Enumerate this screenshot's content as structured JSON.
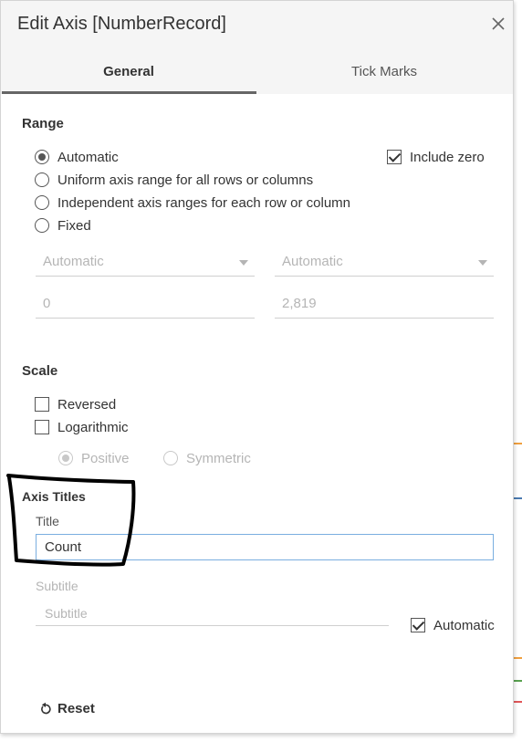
{
  "dialog": {
    "title": "Edit Axis [NumberRecord]"
  },
  "tabs": [
    {
      "label": "General",
      "active": true
    },
    {
      "label": "Tick Marks",
      "active": false
    }
  ],
  "range": {
    "heading": "Range",
    "options": [
      {
        "label": "Automatic",
        "selected": true
      },
      {
        "label": "Uniform axis range for all rows or columns",
        "selected": false
      },
      {
        "label": "Independent axis ranges for each row or column",
        "selected": false
      },
      {
        "label": "Fixed",
        "selected": false
      }
    ],
    "include_zero": {
      "label": "Include zero",
      "checked": true
    },
    "start_dropdown": "Automatic",
    "end_dropdown": "Automatic",
    "start_value": "0",
    "end_value": "2,819"
  },
  "scale": {
    "heading": "Scale",
    "reversed": {
      "label": "Reversed",
      "checked": false
    },
    "logarithmic": {
      "label": "Logarithmic",
      "checked": false
    },
    "positive": {
      "label": "Positive",
      "selected": true
    },
    "symmetric": {
      "label": "Symmetric",
      "selected": false
    }
  },
  "axis_titles": {
    "heading": "Axis Titles",
    "title_label": "Title",
    "title_value": "Count",
    "subtitle_label": "Subtitle",
    "subtitle_placeholder": "Subtitle",
    "automatic": {
      "label": "Automatic",
      "checked": true
    }
  },
  "footer": {
    "reset_label": "Reset"
  },
  "colors": {
    "title_bar_bg": "#f5f5f5",
    "active_tab_underline": "#666666",
    "focus_border": "#7aaee0",
    "annotation_ink": "#000000"
  }
}
